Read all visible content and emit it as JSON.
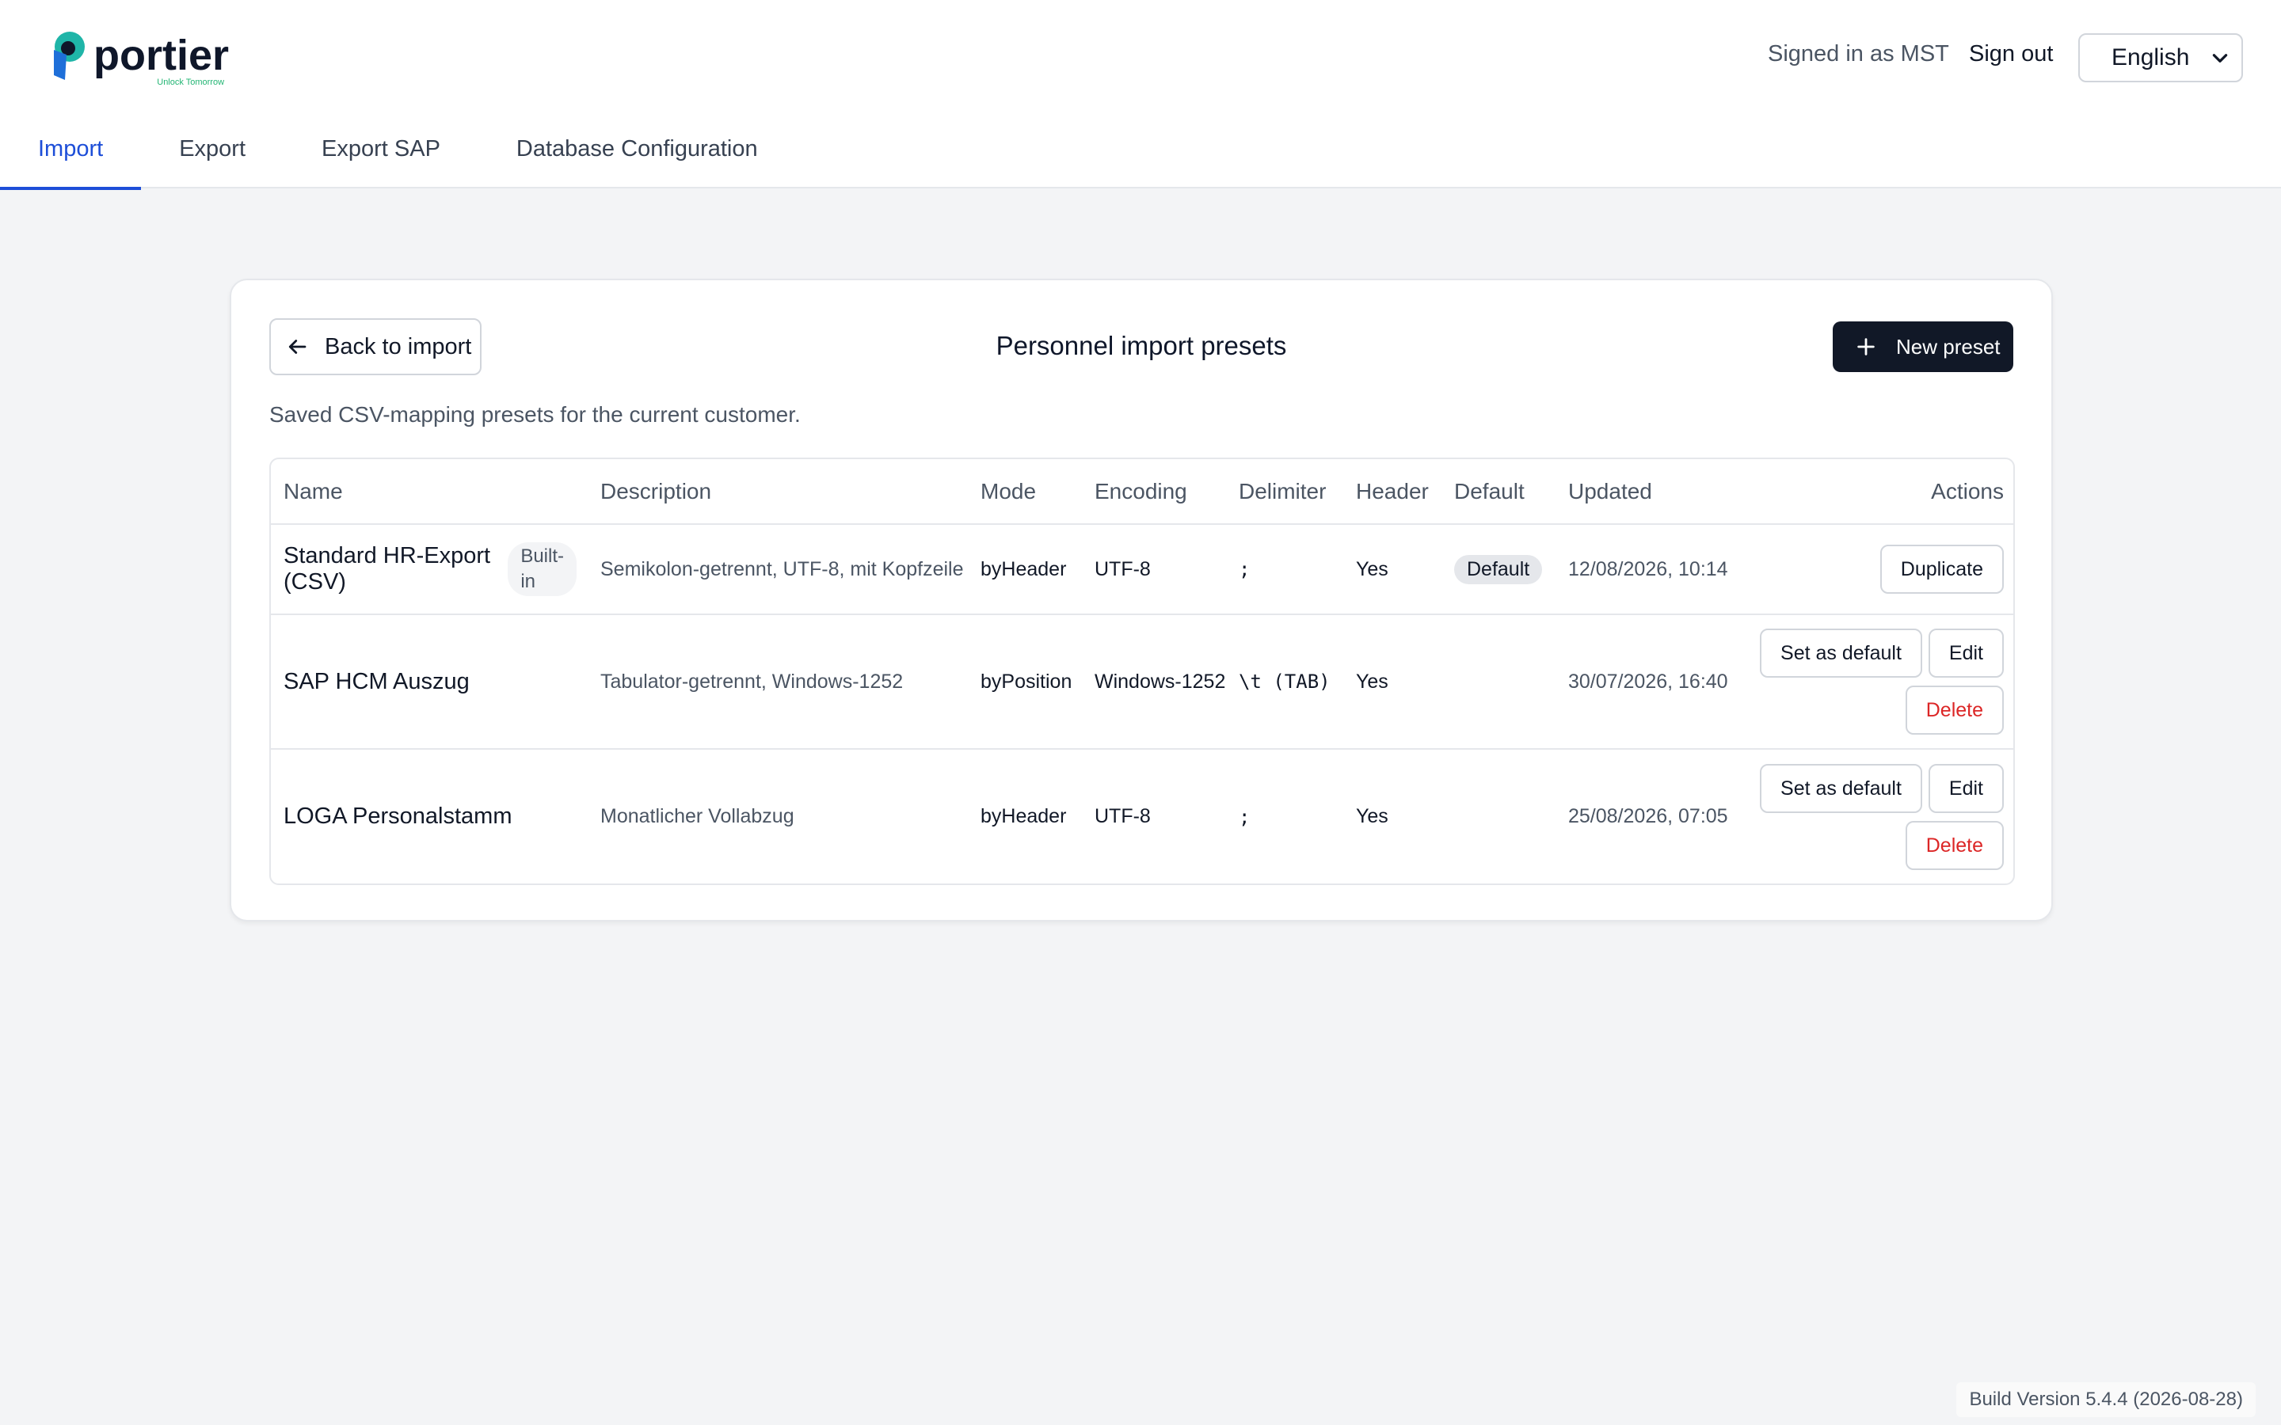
{
  "brand": {
    "name": "portier",
    "tagline": "Unlock Tomorrow",
    "logo_icon": "portier-logo-icon",
    "colors": {
      "primary": "#1d4ed8",
      "logo_blue": "#1e6fd9",
      "logo_teal": "#1fb5a8",
      "tagline": "#22b573"
    }
  },
  "header": {
    "signed_in": "Signed in as MST",
    "sign_out": "Sign out",
    "language": "English"
  },
  "tabs": [
    {
      "label": "Import",
      "active": true
    },
    {
      "label": "Export",
      "active": false
    },
    {
      "label": "Export SAP",
      "active": false
    },
    {
      "label": "Database Configuration",
      "active": false
    }
  ],
  "card": {
    "back_label": "Back to import",
    "title": "Personnel import presets",
    "new_label": "New preset",
    "subtitle": "Saved CSV-mapping presets for the current customer."
  },
  "table": {
    "columns": [
      "Name",
      "Description",
      "Mode",
      "Encoding",
      "Delimiter",
      "Header",
      "Default",
      "Updated",
      "Actions"
    ],
    "rows": [
      {
        "name": "Standard HR-Export (CSV)",
        "badge": "Built-in",
        "description": "Semikolon-getrennt, UTF-8, mit Kopfzeile",
        "mode": "byHeader",
        "encoding": "UTF-8",
        "delimiter": ";",
        "header": "Yes",
        "default": "Default",
        "updated": "12/08/2026, 10:14",
        "actions": {
          "duplicate": "Duplicate"
        }
      },
      {
        "name": "SAP HCM Auszug",
        "description": "Tabulator-getrennt, Windows-1252",
        "mode": "byPosition",
        "encoding": "Windows-1252",
        "delimiter": "\\t (TAB)",
        "header": "Yes",
        "default": "",
        "updated": "30/07/2026, 16:40",
        "actions": {
          "set_default": "Set as default",
          "edit": "Edit",
          "delete": "Delete"
        }
      },
      {
        "name": "LOGA Personalstamm",
        "description": "Monatlicher Vollabzug",
        "mode": "byHeader",
        "encoding": "UTF-8",
        "delimiter": ";",
        "header": "Yes",
        "default": "",
        "updated": "25/08/2026, 07:05",
        "actions": {
          "set_default": "Set as default",
          "edit": "Edit",
          "delete": "Delete"
        }
      }
    ]
  },
  "footer": {
    "build": "Build Version 5.4.4 (2026-08-28)"
  }
}
